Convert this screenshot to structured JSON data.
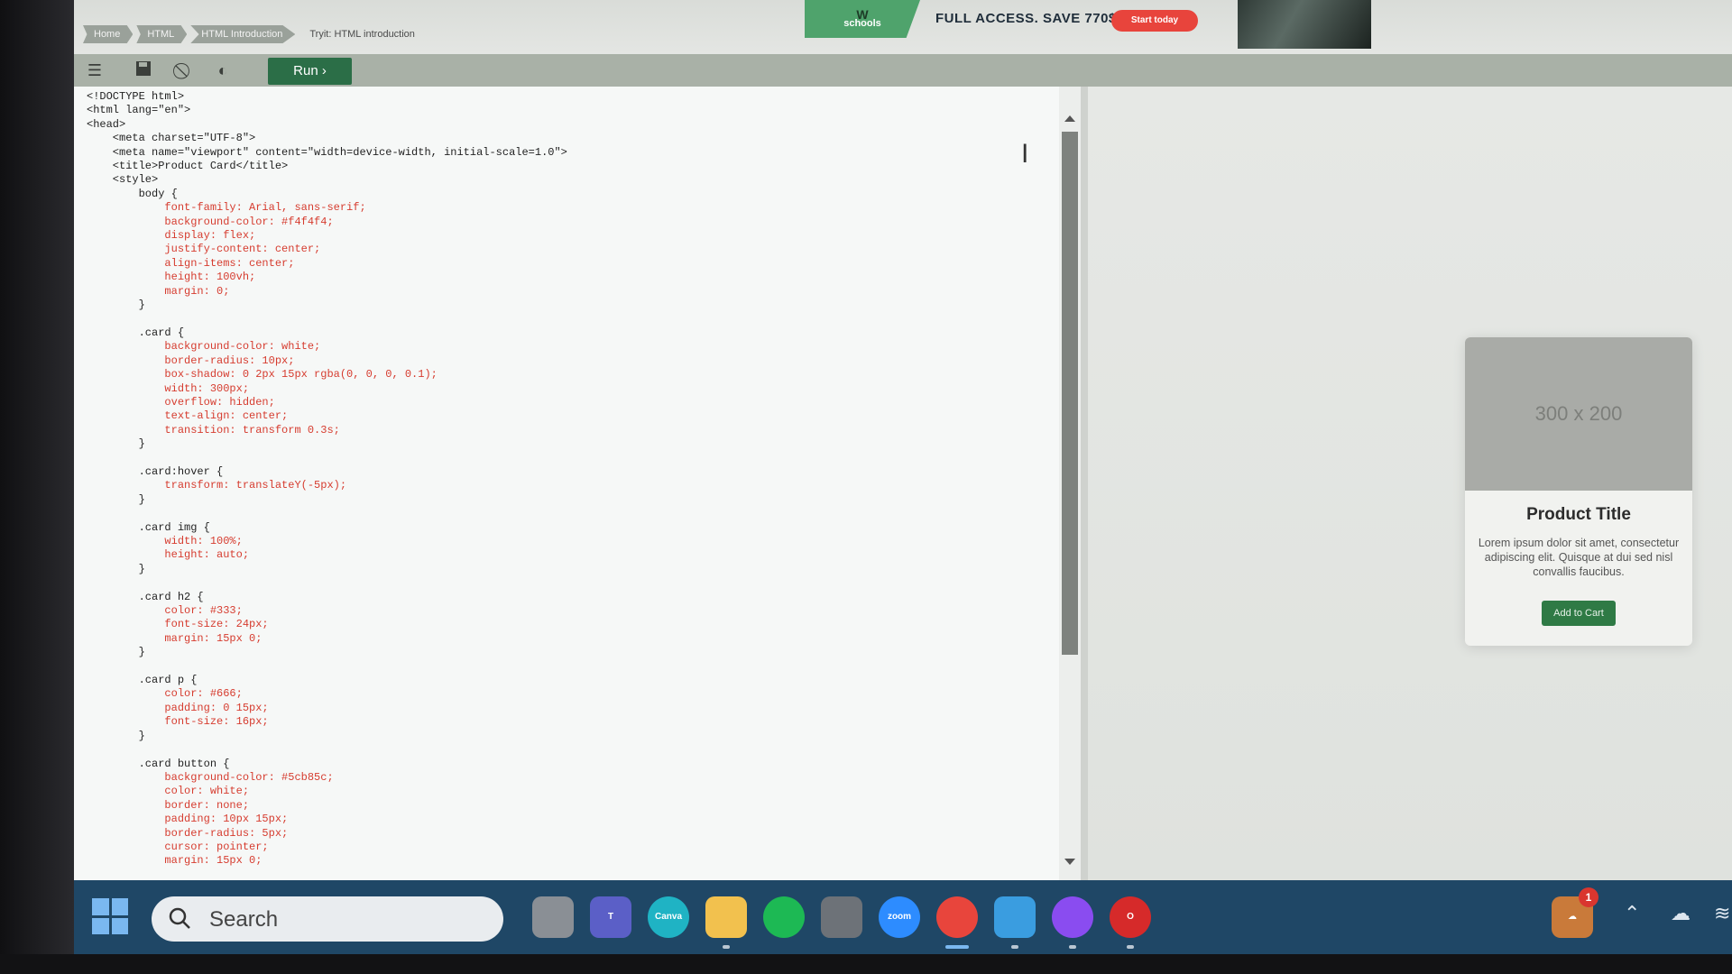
{
  "breadcrumbs": [
    "Home",
    "HTML",
    "HTML Introduction",
    "Tryit: HTML introduction"
  ],
  "ad": {
    "logo_text": "schools",
    "headline": "FULL ACCESS. SAVE 770$",
    "cta_label": "Start today"
  },
  "toolbar": {
    "run_label": "Run",
    "icons": [
      "menu-icon",
      "save-icon",
      "block-icon",
      "contrast-icon"
    ]
  },
  "editor": {
    "code": [
      "<!DOCTYPE html>",
      "<html lang=\"en\">",
      "<head>",
      "    <meta charset=\"UTF-8\">",
      "    <meta name=\"viewport\" content=\"width=device-width, initial-scale=1.0\">",
      "    <title>Product Card</title>",
      "    <style>",
      "        body {",
      "            font-family: Arial, sans-serif;",
      "            background-color: #f4f4f4;",
      "            display: flex;",
      "            justify-content: center;",
      "            align-items: center;",
      "            height: 100vh;",
      "            margin: 0;",
      "        }",
      "",
      "        .card {",
      "            background-color: white;",
      "            border-radius: 10px;",
      "            box-shadow: 0 2px 15px rgba(0, 0, 0, 0.1);",
      "            width: 300px;",
      "            overflow: hidden;",
      "            text-align: center;",
      "            transition: transform 0.3s;",
      "        }",
      "",
      "        .card:hover {",
      "            transform: translateY(-5px);",
      "        }",
      "",
      "        .card img {",
      "            width: 100%;",
      "            height: auto;",
      "        }",
      "",
      "        .card h2 {",
      "            color: #333;",
      "            font-size: 24px;",
      "            margin: 15px 0;",
      "        }",
      "",
      "        .card p {",
      "            color: #666;",
      "            padding: 0 15px;",
      "            font-size: 16px;",
      "        }",
      "",
      "        .card button {",
      "            background-color: #5cb85c;",
      "            color: white;",
      "            border: none;",
      "            padding: 10px 15px;",
      "            border-radius: 5px;",
      "            cursor: pointer;",
      "            margin: 15px 0;"
    ]
  },
  "preview": {
    "image_placeholder": "300 x 200",
    "title": "Product Title",
    "description": "Lorem ipsum dolor sit amet, consectetur adipiscing elit. Quisque at dui sed nisl convallis faucibus.",
    "button_label": "Add to Cart"
  },
  "taskbar": {
    "search_placeholder": "Search",
    "apps": [
      {
        "name": "task-view",
        "label": "",
        "color": "#8a8f95"
      },
      {
        "name": "teams",
        "label": "T",
        "color": "#5b5fc7"
      },
      {
        "name": "canva",
        "label": "Canva",
        "color": "#1fb3c4"
      },
      {
        "name": "file-explorer",
        "label": "",
        "color": "#f2c14e"
      },
      {
        "name": "spotify",
        "label": "",
        "color": "#1db954"
      },
      {
        "name": "calculator",
        "label": "",
        "color": "#6d7278"
      },
      {
        "name": "zoom",
        "label": "zoom",
        "color": "#2d8cff"
      },
      {
        "name": "chrome",
        "label": "",
        "color": "#e8453c"
      },
      {
        "name": "notepad",
        "label": "",
        "color": "#3a9de0"
      },
      {
        "name": "messenger",
        "label": "",
        "color": "#8a4cf0"
      },
      {
        "name": "opera",
        "label": "O",
        "color": "#d62a2a"
      }
    ],
    "notification_count": "1"
  }
}
